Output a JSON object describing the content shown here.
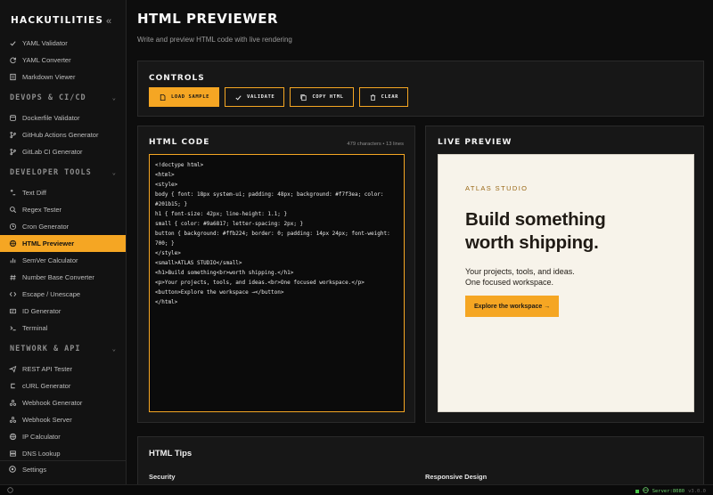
{
  "sidebar": {
    "brand": "HACKUTILITIES",
    "collapse_icon": "double-chevron-left-icon",
    "items_top": [
      {
        "label": "YAML Validator",
        "icon": "check-icon"
      },
      {
        "label": "YAML Converter",
        "icon": "refresh-icon"
      },
      {
        "label": "Markdown Viewer",
        "icon": "document-icon"
      }
    ],
    "sections": [
      {
        "title": "DEVOPS & CI/CD",
        "items": [
          {
            "label": "Dockerfile Validator",
            "icon": "database-icon"
          },
          {
            "label": "GitHub Actions Generator",
            "icon": "git-branch-icon"
          },
          {
            "label": "GitLab CI Generator",
            "icon": "git-branch-icon"
          }
        ]
      },
      {
        "title": "DEVELOPER TOOLS",
        "items": [
          {
            "label": "Text Diff",
            "icon": "diff-icon"
          },
          {
            "label": "Regex Tester",
            "icon": "search-icon"
          },
          {
            "label": "Cron Generator",
            "icon": "clock-icon"
          },
          {
            "label": "HTML Previewer",
            "icon": "globe-icon",
            "active": true
          },
          {
            "label": "SemVer Calculator",
            "icon": "bar-chart-icon"
          },
          {
            "label": "Number Base Converter",
            "icon": "binary-icon"
          },
          {
            "label": "Escape / Unescape",
            "icon": "code-icon"
          },
          {
            "label": "ID Generator",
            "icon": "id-card-icon"
          },
          {
            "label": "Terminal",
            "icon": "terminal-icon"
          }
        ]
      },
      {
        "title": "NETWORK & API",
        "items": [
          {
            "label": "REST API Tester",
            "icon": "send-icon"
          },
          {
            "label": "cURL Generator",
            "icon": "curl-icon"
          },
          {
            "label": "Webhook Generator",
            "icon": "webhook-icon"
          },
          {
            "label": "Webhook Server",
            "icon": "webhook-icon"
          },
          {
            "label": "IP Calculator",
            "icon": "globe-icon"
          },
          {
            "label": "DNS Lookup",
            "icon": "dns-icon"
          }
        ]
      }
    ],
    "settings_label": "Settings"
  },
  "header": {
    "title": "HTML PREVIEWER",
    "subtitle": "Write and preview HTML code with live rendering"
  },
  "controls": {
    "title": "CONTROLS",
    "buttons": [
      {
        "label": "LOAD SAMPLE",
        "icon": "file-icon",
        "primary": true
      },
      {
        "label": "VALIDATE",
        "icon": "check-icon"
      },
      {
        "label": "COPY HTML",
        "icon": "copy-icon"
      },
      {
        "label": "CLEAR",
        "icon": "trash-icon"
      }
    ]
  },
  "editor": {
    "title": "HTML CODE",
    "meta": "479 characters • 13 lines",
    "code": "<!doctype html>\n<html>\n<style>\nbody { font: 18px system-ui; padding: 48px; background: #f7f3ea; color: #201b15; }\nh1 { font-size: 42px; line-height: 1.1; }\nsmall { color: #9a6817; letter-spacing: 2px; }\nbutton { background: #ffb224; border: 0; padding: 14px 24px; font-weight: 700; }\n</style>\n<small>ATLAS STUDIO</small>\n<h1>Build something<br>worth shipping.</h1>\n<p>Your projects, tools, and ideas.<br>One focused workspace.</p>\n<button>Explore the workspace →</button>\n</html>"
  },
  "preview": {
    "title": "LIVE PREVIEW",
    "small": "ATLAS STUDIO",
    "h1_line1": "Build something",
    "h1_line2": "worth shipping.",
    "p_line1": "Your projects, tools, and ideas.",
    "p_line2": "One focused workspace.",
    "button": "Explore the workspace →"
  },
  "tips": {
    "title": "HTML Tips",
    "col1": "Security",
    "col2": "Responsive Design"
  },
  "status": {
    "server": "Server:8080",
    "version": "v3.0.0",
    "accent": "#f5a623",
    "ok_color": "#49c449"
  }
}
